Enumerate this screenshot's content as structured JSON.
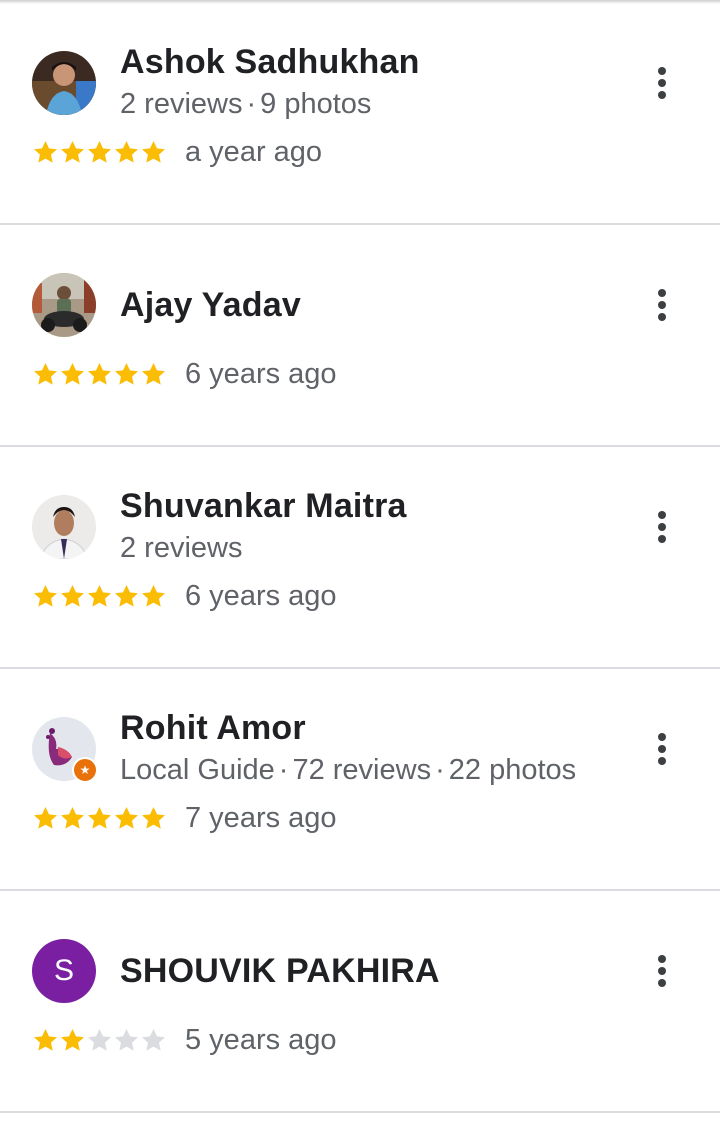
{
  "colors": {
    "star_filled": "#fbbc04",
    "star_empty": "#dadce0",
    "divider": "#dadce0",
    "meta_text": "#5f6368",
    "name_text": "#202124",
    "local_guide_badge": "#e8710a"
  },
  "reviews": [
    {
      "name": "Ashok Sadhukhan",
      "meta": [
        "2 reviews",
        "9 photos"
      ],
      "rating": 5,
      "time": "a year ago",
      "avatar": "photo-avatar"
    },
    {
      "name": "Ajay Yadav",
      "meta": [],
      "rating": 5,
      "time": "6 years ago",
      "avatar": "photo-avatar"
    },
    {
      "name": "Shuvankar Maitra",
      "meta": [
        "2 reviews"
      ],
      "rating": 5,
      "time": "6 years ago",
      "avatar": "photo-avatar"
    },
    {
      "name": "Rohit Amor",
      "meta": [
        "Local Guide",
        "72 reviews",
        "22 photos"
      ],
      "rating": 5,
      "time": "7 years ago",
      "avatar": "photo-avatar",
      "local_guide": true
    },
    {
      "name": "SHOUVIK PAKHIRA",
      "meta": [],
      "rating": 2,
      "time": "5 years ago",
      "avatar": "letter-avatar",
      "avatar_letter": "S",
      "avatar_color": "#7b1fa2"
    }
  ],
  "icons": {
    "star": "star-icon",
    "more": "more-vert-icon"
  }
}
